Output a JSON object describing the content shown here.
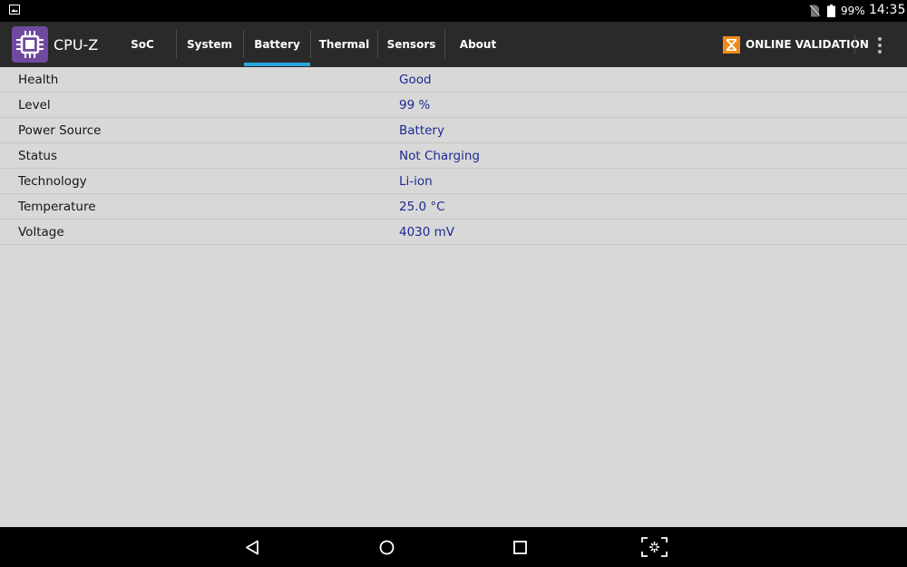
{
  "status_bar": {
    "battery_percent": "99%",
    "time": "14:35",
    "icons": [
      "gallery-icon",
      "no-sim-icon",
      "battery-icon"
    ]
  },
  "app": {
    "title": "CPU-Z",
    "tabs": [
      {
        "label": "SoC"
      },
      {
        "label": "System"
      },
      {
        "label": "Battery",
        "active": true
      },
      {
        "label": "Thermal"
      },
      {
        "label": "Sensors"
      },
      {
        "label": "About"
      }
    ],
    "validation_label": "ONLINE VALIDATION",
    "accent_color": "#29a6dc",
    "logo_color": "#6f4a9f"
  },
  "battery": {
    "rows": [
      {
        "key": "Health",
        "value": "Good"
      },
      {
        "key": "Level",
        "value": "99 %"
      },
      {
        "key": "Power Source",
        "value": "Battery"
      },
      {
        "key": "Status",
        "value": "Not Charging"
      },
      {
        "key": "Technology",
        "value": "Li-ion"
      },
      {
        "key": "Temperature",
        "value": "25.0 °C"
      },
      {
        "key": "Voltage",
        "value": "4030 mV"
      }
    ]
  },
  "nav_bar": {
    "icons": [
      "back-icon",
      "home-icon",
      "recents-icon",
      "screenshot-icon"
    ]
  }
}
